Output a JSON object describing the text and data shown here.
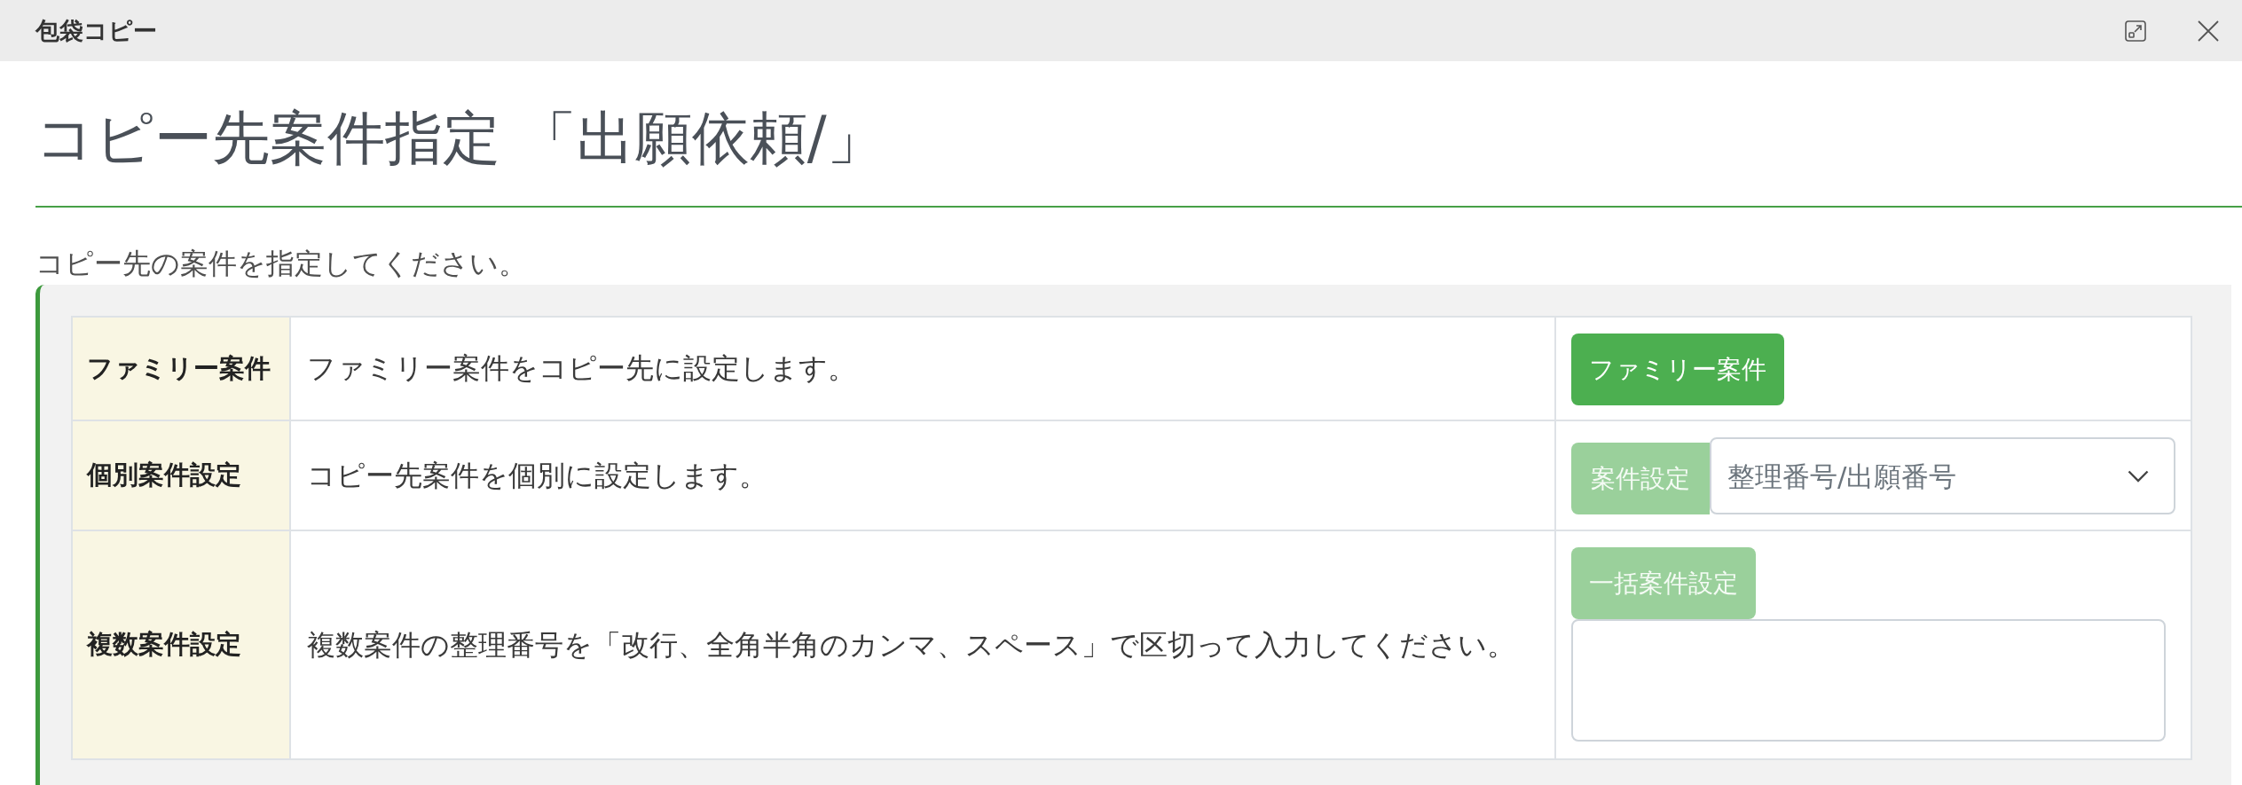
{
  "window": {
    "title": "包袋コピー"
  },
  "heading": "コピー先案件指定 「出願依頼/」",
  "instruction": "コピー先の案件を指定してください。",
  "options": [
    {
      "kind": "button",
      "label": "ファミリー案件",
      "description": "ファミリー案件をコピー先に設定します。",
      "button": {
        "label": "ファミリー案件",
        "disabled": false
      }
    },
    {
      "kind": "select",
      "label": "個別案件設定",
      "description": "コピー先案件を個別に設定します。",
      "button": {
        "label": "案件設定",
        "disabled": true
      },
      "select": {
        "placeholder": "整理番号/出願番号"
      }
    },
    {
      "kind": "bulk",
      "label": "複数案件設定",
      "description": "複数案件の整理番号を「改行、全角半角のカンマ、スペース」で区切って入力してください。",
      "button": {
        "label": "一括案件設定",
        "disabled": true
      }
    }
  ]
}
